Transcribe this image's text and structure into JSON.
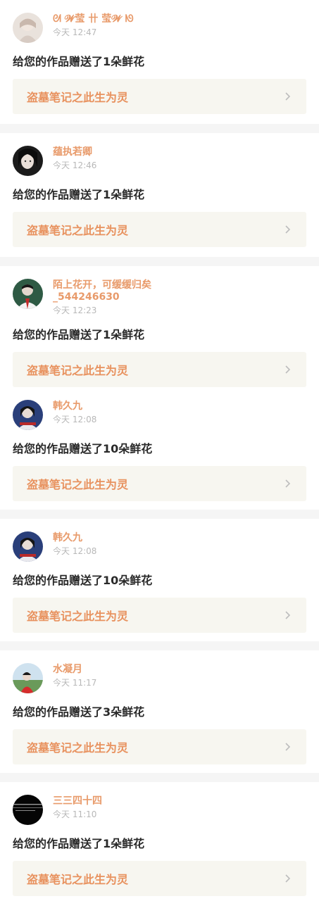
{
  "entries": [
    {
      "user": "ᘛ 𝓦莹 卄 莹𝓦 ᘚ",
      "time": "今天 12:47",
      "message": "给您的作品赠送了1朵鲜花",
      "work": "盗墓笔记之此生为灵",
      "avatar": "avatar-girl-icon",
      "sep_after": true
    },
    {
      "user": "蕴执若卿",
      "time": "今天 12:46",
      "message": "给您的作品赠送了1朵鲜花",
      "work": "盗墓笔记之此生为灵",
      "avatar": "avatar-dark-hair-icon",
      "sep_after": true
    },
    {
      "user": "陌上花开，可缓缓归矣_544246630",
      "user_line1": "陌上花开，可缓缓归矣",
      "user_line2": "_544246630",
      "time": "今天 12:23",
      "message": "给您的作品赠送了1朵鲜花",
      "work": "盗墓笔记之此生为灵",
      "avatar": "avatar-green-icon",
      "sep_after": false
    },
    {
      "user": "韩久九",
      "time": "今天 12:08",
      "message": "给您的作品赠送了10朵鲜花",
      "work": "盗墓笔记之此生为灵",
      "avatar": "avatar-blue-icon",
      "sep_after": true
    },
    {
      "user": "韩久九",
      "time": "今天 12:08",
      "message": "给您的作品赠送了10朵鲜花",
      "work": "盗墓笔记之此生为灵",
      "avatar": "avatar-blue-icon",
      "sep_after": true
    },
    {
      "user": "水凝月",
      "time": "今天 11:17",
      "message": "给您的作品赠送了3朵鲜花",
      "work": "盗墓笔记之此生为灵",
      "avatar": "avatar-red-icon",
      "sep_after": true
    },
    {
      "user": "三三四十四",
      "time": "今天 11:10",
      "message": "给您的作品赠送了1朵鲜花",
      "work": "盗墓笔记之此生为灵",
      "avatar": "avatar-black-icon",
      "sep_after": false
    }
  ],
  "colors": {
    "accent": "#e8925f",
    "card_bg": "#f7f6f0",
    "separator": "#f5f5f5",
    "time": "#b8b8b8"
  }
}
